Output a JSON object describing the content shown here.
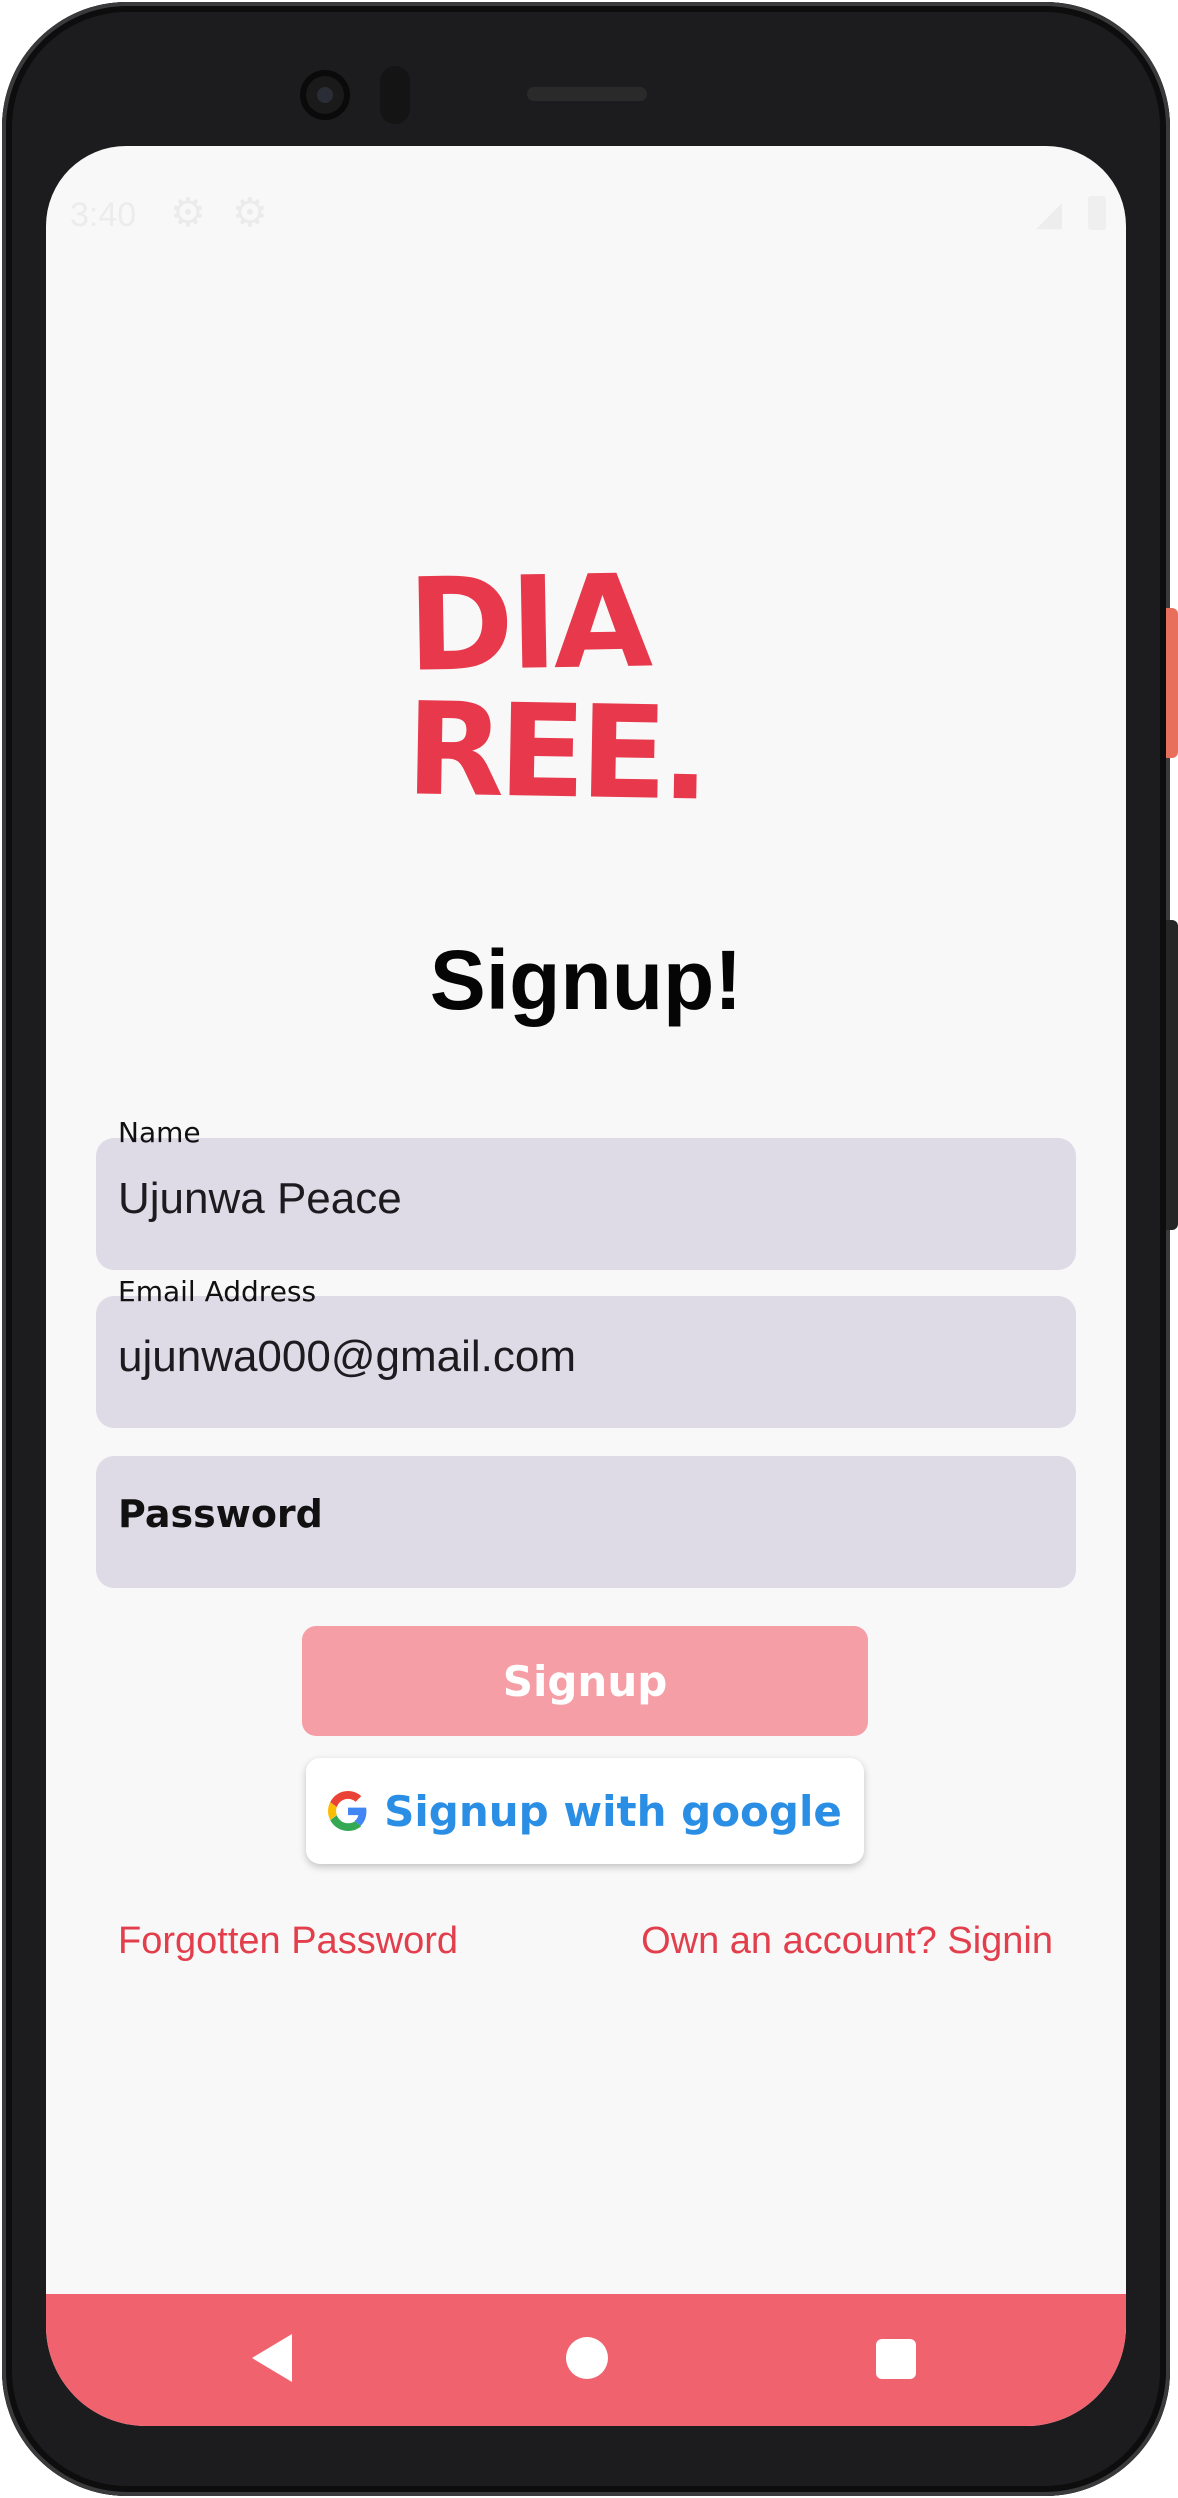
{
  "status_bar": {
    "time": "3:40"
  },
  "logo": {
    "line1": "DIA",
    "line2": "REE.",
    "color": "#e8384b"
  },
  "page": {
    "title": "Signup!"
  },
  "form": {
    "name_label": "Name",
    "name_value": "Ujunwa Peace",
    "email_label": "Email Address",
    "email_value": "ujunwa000@gmail.com",
    "password_placeholder": "Password"
  },
  "buttons": {
    "signup_label": "Signup",
    "google_label": "Signup with google"
  },
  "links": {
    "forgot_password": "Forgotten Password",
    "signin": "Own an account? Signin"
  },
  "colors": {
    "accent": "#e23e4c",
    "signup_button": "#f59ea5",
    "google_text": "#2b8ee5",
    "nav_bar": "#f0636e",
    "field_bg": "#dedbe6"
  },
  "icons": {
    "status": [
      "gear-icon",
      "gear-icon",
      "signal-icon",
      "battery-icon"
    ],
    "google": "google-g-icon",
    "nav": [
      "back-triangle-icon",
      "home-circle-icon",
      "recents-square-icon"
    ]
  }
}
